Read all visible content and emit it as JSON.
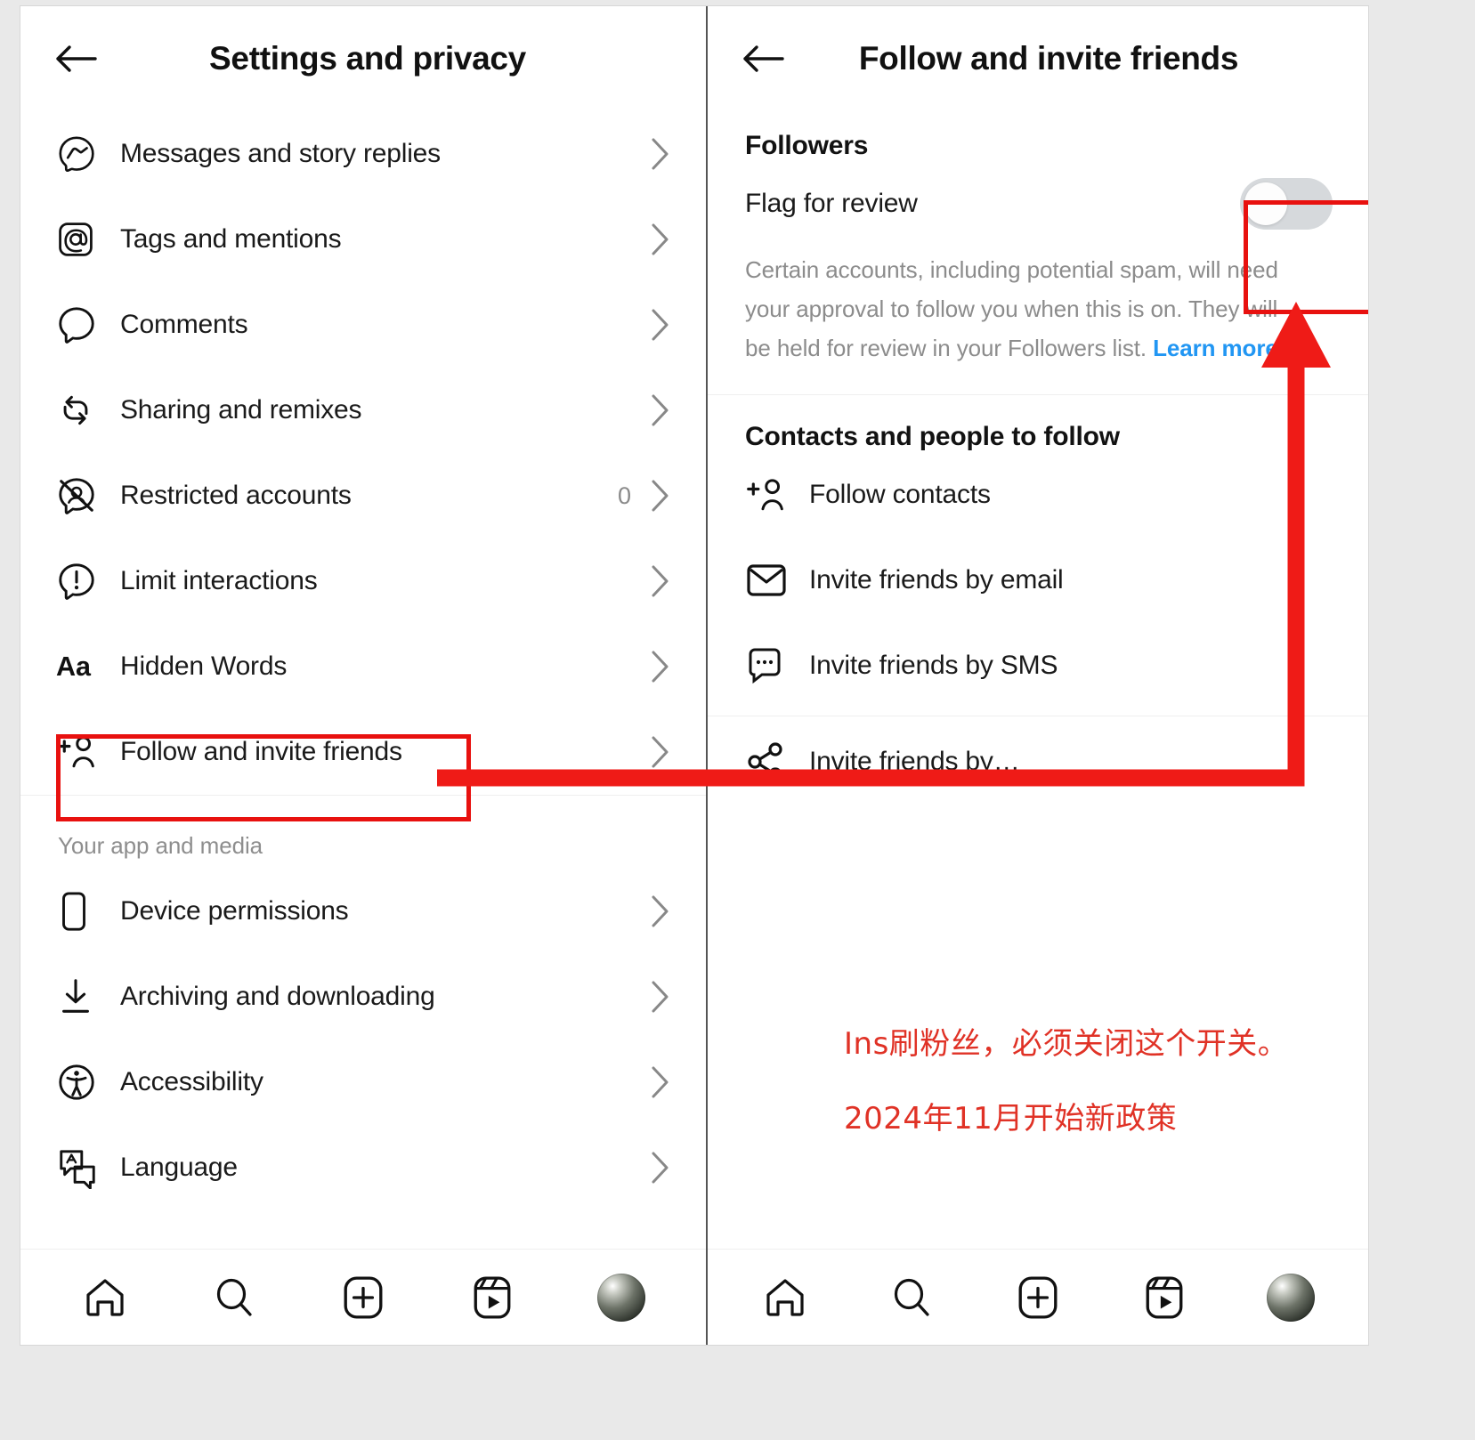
{
  "left_panel": {
    "back_icon": "back-arrow-icon",
    "title": "Settings and privacy",
    "items": [
      {
        "icon": "messenger-icon",
        "label": "Messages and story replies",
        "count": "",
        "chevron": "chevron-right-icon"
      },
      {
        "icon": "at-mention-icon",
        "label": "Tags and mentions",
        "count": "",
        "chevron": "chevron-right-icon"
      },
      {
        "icon": "comment-bubble-icon",
        "label": "Comments",
        "count": "",
        "chevron": "chevron-right-icon"
      },
      {
        "icon": "share-remix-icon",
        "label": "Sharing and remixes",
        "count": "",
        "chevron": "chevron-right-icon"
      },
      {
        "icon": "restricted-account-icon",
        "label": "Restricted accounts",
        "count": "0",
        "chevron": "chevron-right-icon"
      },
      {
        "icon": "limit-interactions-icon",
        "label": "Limit interactions",
        "count": "",
        "chevron": "chevron-right-icon"
      },
      {
        "icon": "hidden-words-aa-icon",
        "label": "Hidden Words",
        "count": "",
        "chevron": "chevron-right-icon"
      },
      {
        "icon": "add-person-icon",
        "label": "Follow and invite friends",
        "count": "",
        "chevron": "chevron-right-icon"
      }
    ],
    "section_caption": "Your app and media",
    "media_items": [
      {
        "icon": "device-phone-icon",
        "label": "Device permissions",
        "chevron": "chevron-right-icon"
      },
      {
        "icon": "download-icon",
        "label": "Archiving and downloading",
        "chevron": "chevron-right-icon"
      },
      {
        "icon": "accessibility-icon",
        "label": "Accessibility",
        "chevron": "chevron-right-icon"
      },
      {
        "icon": "language-translate-icon",
        "label": "Language",
        "chevron": "chevron-right-icon"
      }
    ]
  },
  "right_panel": {
    "back_icon": "back-arrow-icon",
    "title": "Follow and invite friends",
    "followers_group": "Followers",
    "flag_for_review": {
      "label": "Flag for review",
      "toggle_state": "off",
      "toggle_track_color": "#d6d9dc",
      "toggle_knob_color": "#fdfdfd"
    },
    "description": {
      "text": "Certain accounts, including potential spam, will need your approval to follow you when this is on. They will be held for review in your Followers list. ",
      "link": "Learn more",
      "link_color": "#2196f3",
      "trailing": "."
    },
    "contacts_group": "Contacts and people to follow",
    "contact_items": [
      {
        "icon": "add-person-icon",
        "label": "Follow contacts"
      },
      {
        "icon": "envelope-icon",
        "label": "Invite friends by email"
      },
      {
        "icon": "sms-bubble-icon",
        "label": "Invite friends by SMS"
      },
      {
        "icon": "share-nodes-icon",
        "label": "Invite friends by…"
      }
    ]
  },
  "bottom_nav": {
    "items": [
      {
        "icon": "home-icon",
        "label": "Home"
      },
      {
        "icon": "search-icon",
        "label": "Search"
      },
      {
        "icon": "create-plus-icon",
        "label": "Create"
      },
      {
        "icon": "reels-icon",
        "label": "Reels"
      },
      {
        "icon": "profile-avatar",
        "label": "Profile"
      }
    ]
  },
  "annotations": {
    "highlight_color": "#e8110f",
    "arrow_color": "#ef1b17",
    "note_color": "#e03226",
    "note_line1": "Ins刷粉丝，必须关闭这个开关。",
    "note_line2": "2024年11月开始新政策"
  }
}
